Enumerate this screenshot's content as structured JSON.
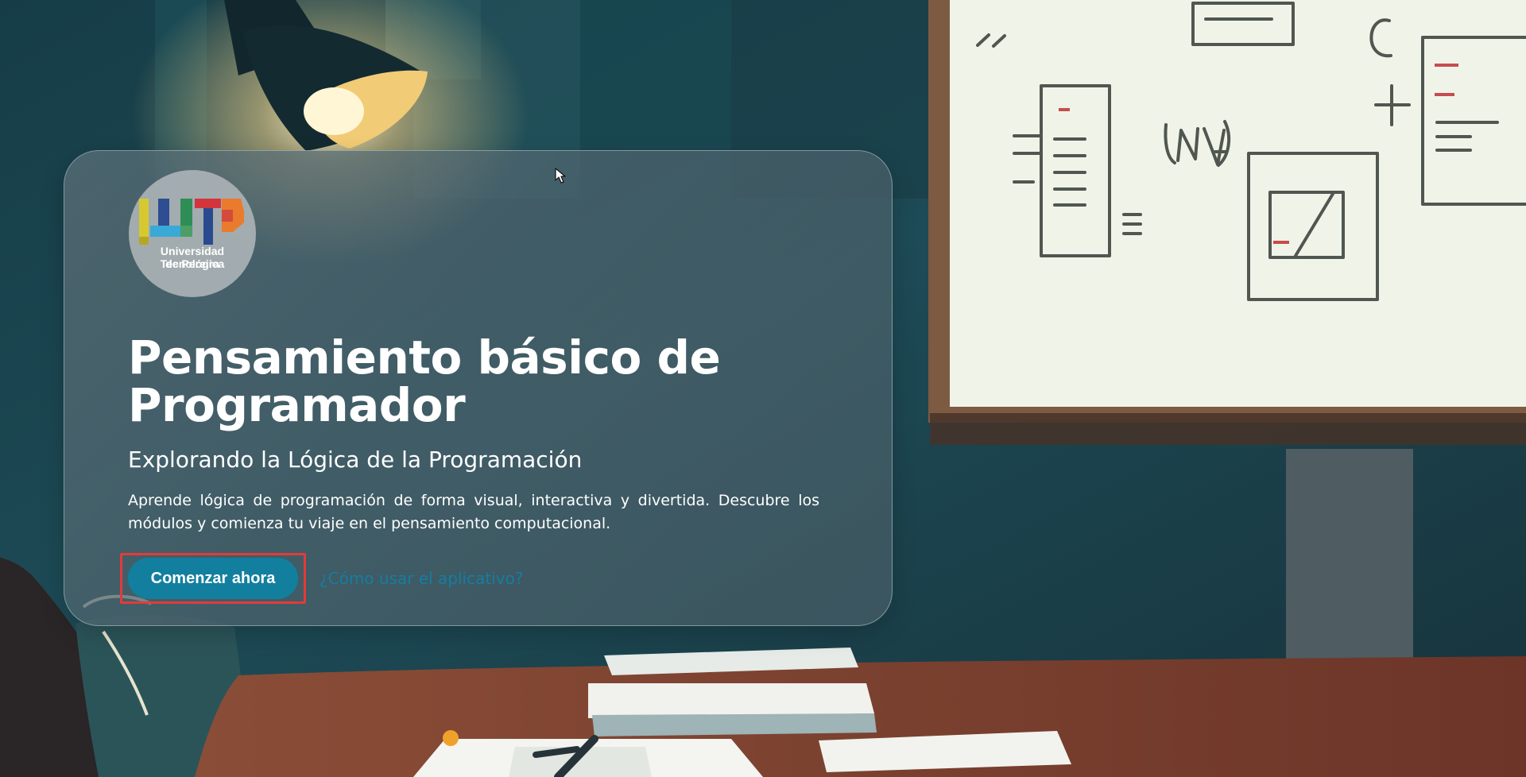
{
  "logo": {
    "line1": "Universidad Tecnológica",
    "line2": "de Pereira"
  },
  "hero": {
    "title": "Pensamiento básico de Programador",
    "subtitle": "Explorando la Lógica de la Programación",
    "description": "Aprende lógica de programación de forma visual, interactiva y divertida. Descubre los módulos y comienza tu viaje en el pensamiento computacional.",
    "start_button_label": "Comenzar ahora",
    "help_link_label": "¿Cómo usar el aplicativo?"
  },
  "colors": {
    "card": "#4a6069",
    "primary_button": "#127f9e",
    "link": "#147ea1",
    "highlight": "#e23b3a"
  },
  "icons": {
    "cursor": "mouse-pointer-icon"
  }
}
